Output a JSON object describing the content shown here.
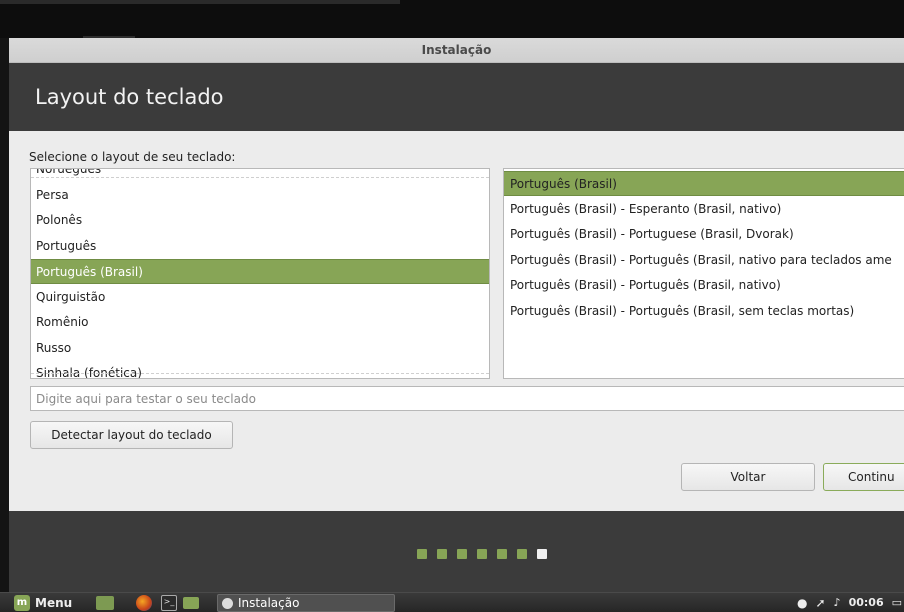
{
  "window": {
    "title": "Instalação"
  },
  "header": {
    "title": "Layout do teclado"
  },
  "prompt": "Selecione o layout de seu teclado:",
  "layouts": [
    {
      "label": "Norueguês",
      "selected": false
    },
    {
      "label": "Persa",
      "selected": false
    },
    {
      "label": "Polonês",
      "selected": false
    },
    {
      "label": "Português",
      "selected": false
    },
    {
      "label": "Português (Brasil)",
      "selected": true
    },
    {
      "label": "Quirguistão",
      "selected": false
    },
    {
      "label": "Romênio",
      "selected": false
    },
    {
      "label": "Russo",
      "selected": false
    },
    {
      "label": "Sinhala (fonética)",
      "selected": false
    }
  ],
  "variants": [
    {
      "label": "Português (Brasil)",
      "selected": true
    },
    {
      "label": "Português (Brasil) - Esperanto (Brasil, nativo)",
      "selected": false
    },
    {
      "label": "Português (Brasil) - Portuguese (Brasil, Dvorak)",
      "selected": false
    },
    {
      "label": "Português (Brasil) - Português (Brasil, nativo para teclados ame",
      "selected": false
    },
    {
      "label": "Português (Brasil) - Português (Brasil, nativo)",
      "selected": false
    },
    {
      "label": "Português (Brasil) - Português (Brasil, sem teclas mortas)",
      "selected": false
    }
  ],
  "test_input": {
    "placeholder": "Digite aqui para testar o seu teclado",
    "value": ""
  },
  "buttons": {
    "detect": "Detectar layout do teclado",
    "back": "Voltar",
    "continue": "Continu"
  },
  "progress": {
    "total_steps": 7,
    "current_step": 7
  },
  "taskbar": {
    "menu_label": "Menu",
    "task_label": "Instalação",
    "clock": "00:06",
    "icons": [
      "mint-logo-icon",
      "show-desktop-icon",
      "firefox-icon",
      "terminal-icon",
      "files-icon",
      "cd-icon",
      "user-icon",
      "network-icon",
      "volume-icon",
      "display-icon"
    ]
  },
  "colors": {
    "accent": "#87a556",
    "header_bg": "#3b3b3b",
    "window_bg": "#ececec"
  }
}
